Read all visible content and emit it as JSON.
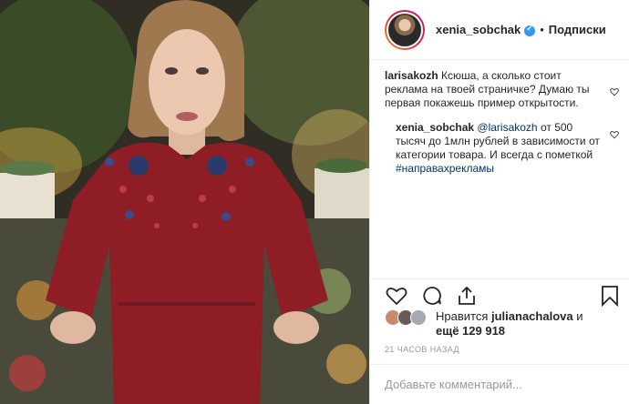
{
  "header": {
    "username": "xenia_sobchak",
    "separator": "•",
    "follow_label": "Подписки"
  },
  "comments": [
    {
      "user": "larisakozh",
      "text": "Ксюша, а сколько стоит реклама на твоей страничке? Думаю ты первая покажешь пример открытости."
    },
    {
      "user": "xenia_sobchak",
      "mention": "@larisakozh",
      "text": "от 500 тысяч до 1млн рублей в зависимости от категории товара. И всегда с пометкой",
      "hashtag": "#направахрекламы"
    }
  ],
  "actions": {
    "like_icon": "heart-icon",
    "comment_icon": "comment-icon",
    "share_icon": "share-icon",
    "save_icon": "bookmark-icon"
  },
  "likes": {
    "prefix": "Нравится",
    "user": "julianachalova",
    "connector": "и",
    "rest": "ещё 129 918"
  },
  "timestamp": "21 ЧАСОВ НАЗАД",
  "add_comment": {
    "placeholder": "Добавьте комментарий..."
  },
  "colors": {
    "dress": "#8e1d26",
    "link": "#003569",
    "verified": "#3897f0",
    "border": "#efefef"
  }
}
